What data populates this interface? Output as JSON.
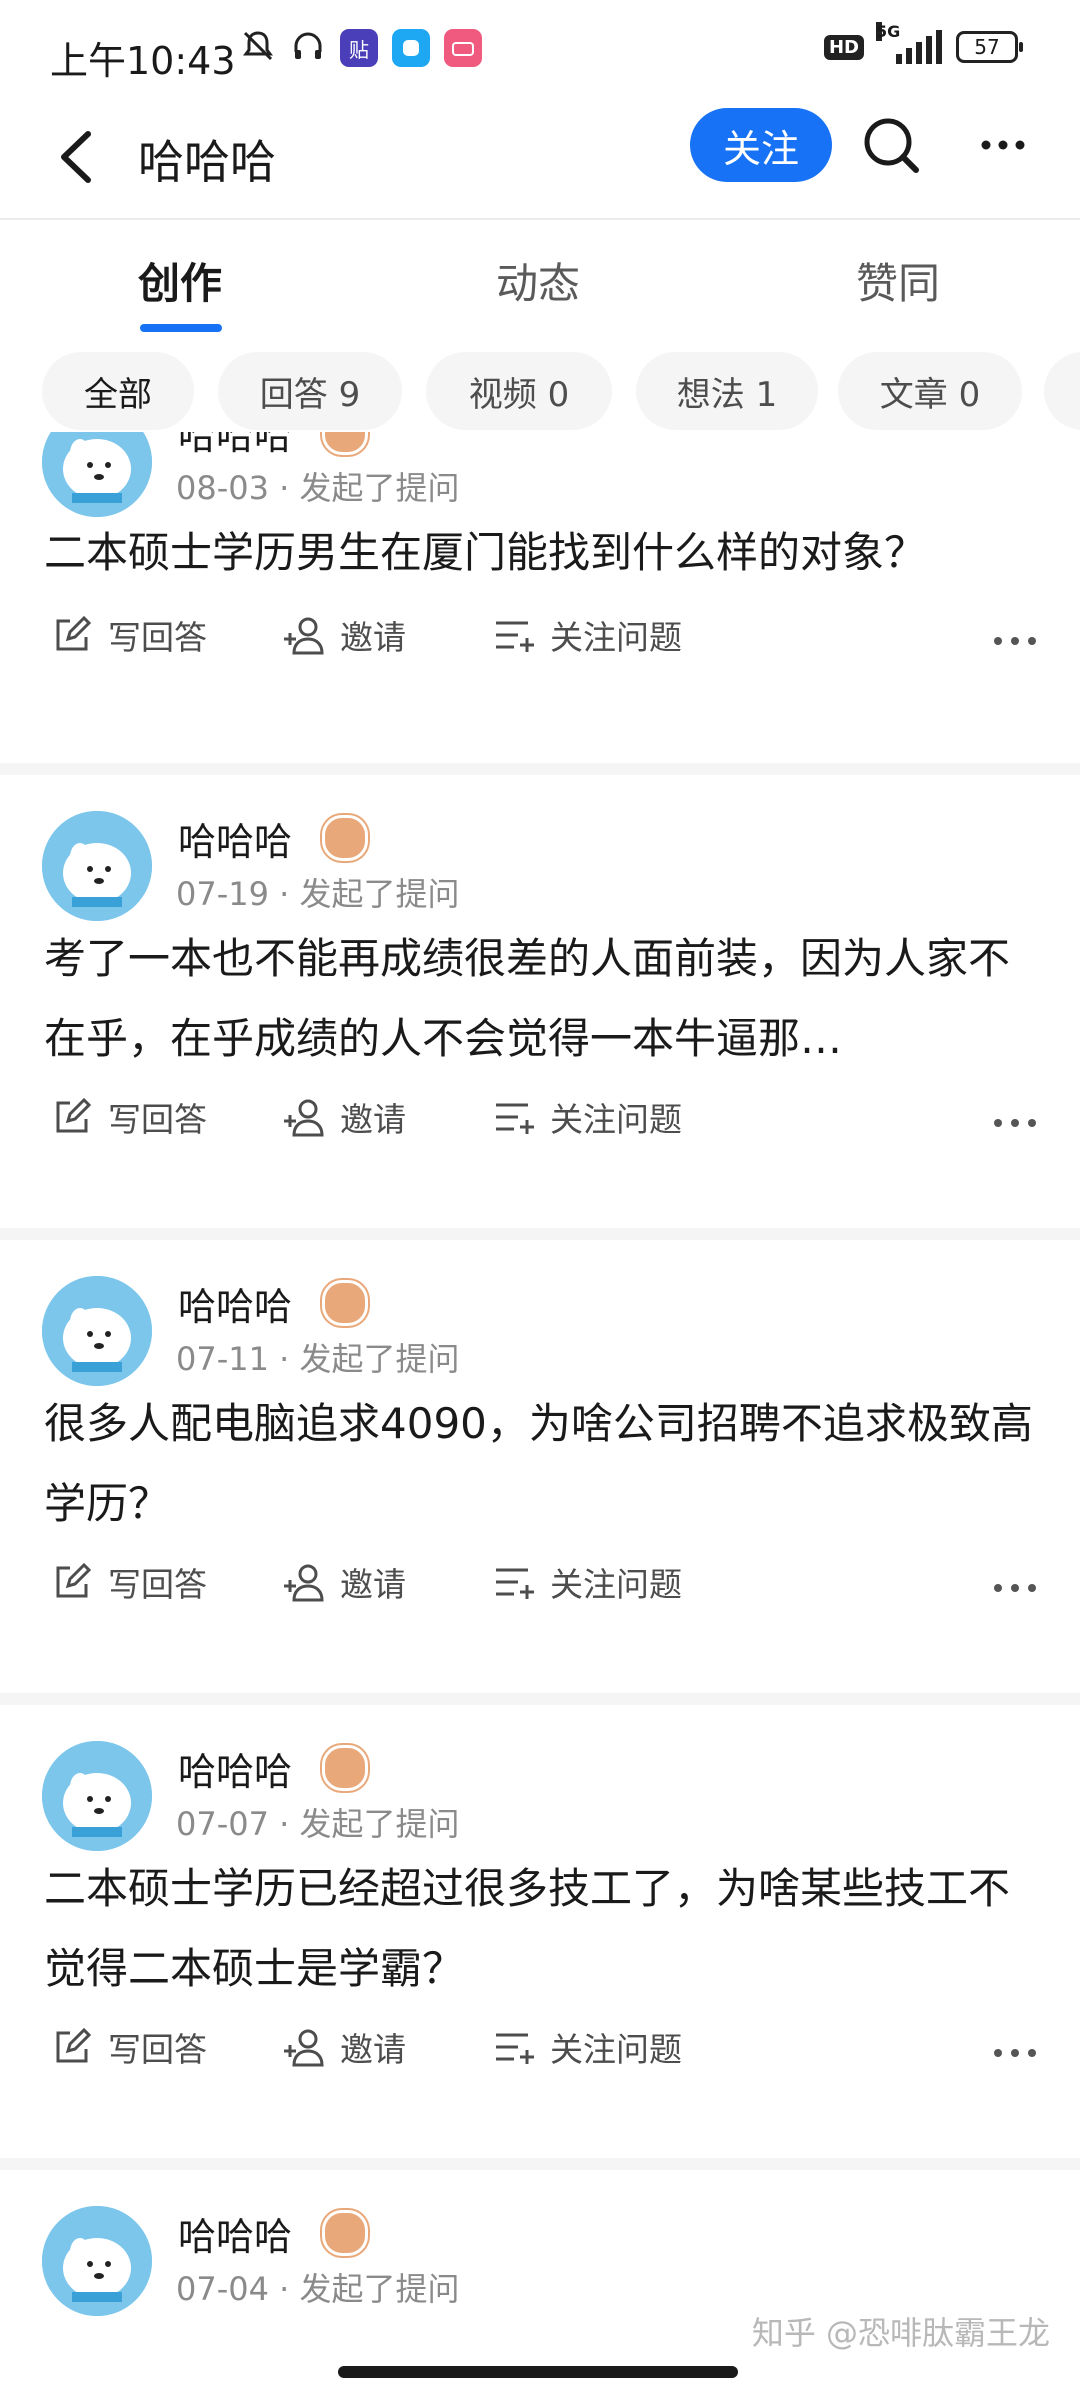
{
  "status_bar": {
    "time": "上午10:43",
    "hd": "HD",
    "network": "5G",
    "battery": "57"
  },
  "header": {
    "title": "哈哈哈",
    "follow_label": "关注"
  },
  "tabs": [
    {
      "label": "创作",
      "active": true
    },
    {
      "label": "动态",
      "active": false
    },
    {
      "label": "赞同",
      "active": false
    }
  ],
  "filters": [
    {
      "label": "全部",
      "active": true
    },
    {
      "label": "回答 9",
      "active": false
    },
    {
      "label": "视频 0",
      "active": false
    },
    {
      "label": "想法 1",
      "active": false
    },
    {
      "label": "文章 0",
      "active": false
    }
  ],
  "action_labels": {
    "write_answer": "写回答",
    "invite": "邀请",
    "follow_question": "关注问题"
  },
  "feed": [
    {
      "author": "哈哈哈",
      "date": "08-03",
      "action": "发起了提问",
      "question": "二本硕士学历男生在厦门能找到什么样的对象？"
    },
    {
      "author": "哈哈哈",
      "date": "07-19",
      "action": "发起了提问",
      "question": "考了一本也不能再成绩很差的人面前装，因为人家不在乎，在乎成绩的人不会觉得一本牛逼那…"
    },
    {
      "author": "哈哈哈",
      "date": "07-11",
      "action": "发起了提问",
      "question": "很多人配电脑追求4090，为啥公司招聘不追求极致高学历？"
    },
    {
      "author": "哈哈哈",
      "date": "07-07",
      "action": "发起了提问",
      "question": "二本硕士学历已经超过很多技工了，为啥某些技工不觉得二本硕士是学霸？"
    },
    {
      "author": "哈哈哈",
      "date": "07-04",
      "action": "发起了提问",
      "question": ""
    }
  ],
  "watermark": "知乎 @恐啡肽霸王龙",
  "colors": {
    "accent": "#1772f6",
    "chip_bg": "#f5f5f6",
    "muted_text": "#8a8a8a",
    "badge": "#e9a87a"
  }
}
